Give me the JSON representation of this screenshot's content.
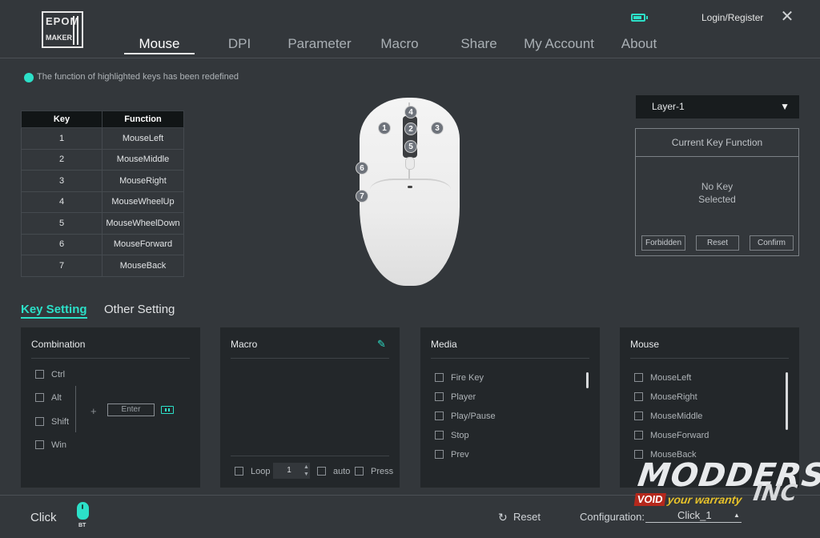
{
  "logo": {
    "line1": "EPOM",
    "line2": "MAKER"
  },
  "nav": {
    "tabs": [
      {
        "label": "Mouse"
      },
      {
        "label": "DPI"
      },
      {
        "label": "Parameter"
      },
      {
        "label": "Macro"
      },
      {
        "label": "Share"
      },
      {
        "label": "My Account"
      },
      {
        "label": "About"
      }
    ],
    "active": "Mouse"
  },
  "header": {
    "login_label": "Login/Register",
    "close_glyph": "✕"
  },
  "notice": {
    "text": "The function of highlighted keys has been redefined"
  },
  "key_table": {
    "headers": [
      "Key",
      "Function"
    ],
    "rows": [
      {
        "key": "1",
        "function": "MouseLeft"
      },
      {
        "key": "2",
        "function": "MouseMiddle"
      },
      {
        "key": "3",
        "function": "MouseRight"
      },
      {
        "key": "4",
        "function": "MouseWheelUp"
      },
      {
        "key": "5",
        "function": "MouseWheelDown"
      },
      {
        "key": "6",
        "function": "MouseForward"
      },
      {
        "key": "7",
        "function": "MouseBack"
      }
    ]
  },
  "mouse_badges": [
    "1",
    "2",
    "3",
    "4",
    "5",
    "6",
    "7"
  ],
  "layer": {
    "selected": "Layer-1",
    "caret": "▼"
  },
  "current_key_function": {
    "title": "Current Key Function",
    "empty_line1": "No Key",
    "empty_line2": "Selected",
    "buttons": {
      "forbidden": "Forbidden",
      "reset": "Reset",
      "confirm": "Confirm"
    }
  },
  "setting_tabs": {
    "key_setting": "Key Setting",
    "other_setting": "Other Setting"
  },
  "combination": {
    "title": "Combination",
    "modifiers": [
      "Ctrl",
      "Alt",
      "Shift",
      "Win"
    ],
    "plus": "+",
    "key_placeholder": "Enter"
  },
  "macro": {
    "title": "Macro",
    "edit_glyph": "✎",
    "loop_label": "Loop",
    "loop_count": "1",
    "auto_label": "auto",
    "press_label": "Press"
  },
  "media": {
    "title": "Media",
    "items": [
      "Fire Key",
      "Player",
      "Play/Pause",
      "Stop",
      "Prev"
    ]
  },
  "mouse_functions": {
    "title": "Mouse",
    "items": [
      "MouseLeft",
      "MouseRight",
      "MouseMiddle",
      "MouseForward",
      "MouseBack"
    ]
  },
  "footer": {
    "mode_label": "Click",
    "connection_label": "BT",
    "reset_glyph": "↻",
    "reset_label": "Reset",
    "config_label": "Configuration:",
    "config_value": "Click_1",
    "config_caret": "▲"
  },
  "watermark": {
    "brand": "MODDERS",
    "suffix": "INC",
    "void": "VOID",
    "tagline": "your warranty"
  },
  "colors": {
    "accent": "#2ce0c8",
    "background": "#33373b",
    "card": "#23272a",
    "table_header": "#111516"
  }
}
